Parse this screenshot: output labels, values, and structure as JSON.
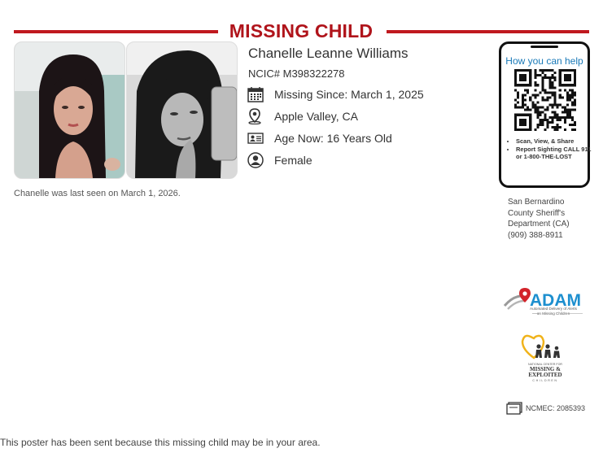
{
  "header": {
    "title": "MISSING CHILD",
    "accent_color": "#c0191f"
  },
  "child": {
    "name": "Chanelle Leanne Williams",
    "ncic": "NCIC# M398322278",
    "missing_since": "Missing Since: March 1, 2025",
    "location": "Apple Valley, CA",
    "age": "Age Now: 16 Years Old",
    "sex": "Female",
    "last_seen": "Chanelle was last seen on March 1, 2026."
  },
  "photos": [
    {
      "name": "photo-1"
    },
    {
      "name": "photo-2"
    }
  ],
  "icons": {
    "missing_since": "calendar-icon",
    "location": "map-pin-icon",
    "age": "id-card-icon",
    "sex": "person-icon",
    "case": "case-files-icon"
  },
  "help_panel": {
    "title": "How you can help",
    "tips": [
      "Scan, View, & Share",
      "Report Sighting CALL 911 or 1-800-THE-LOST"
    ]
  },
  "agency": {
    "line1": "San Bernardino",
    "line2": "County Sheriff's",
    "line3": "Department (CA)",
    "phone": "(909) 388-8911"
  },
  "logos": {
    "adam_word": "ADAM",
    "adam_tagline_1": "Automated Delivery of Alerts",
    "adam_tagline_2": "on Missing Children",
    "ncmec_line1": "NATIONAL CENTER FOR",
    "ncmec_line2": "MISSING &",
    "ncmec_line3": "EXPLOITED",
    "ncmec_line4": "CHILDREN"
  },
  "case_number": "NCMEC: 2085393",
  "footer": "This poster has been sent because this missing child may be in your area."
}
